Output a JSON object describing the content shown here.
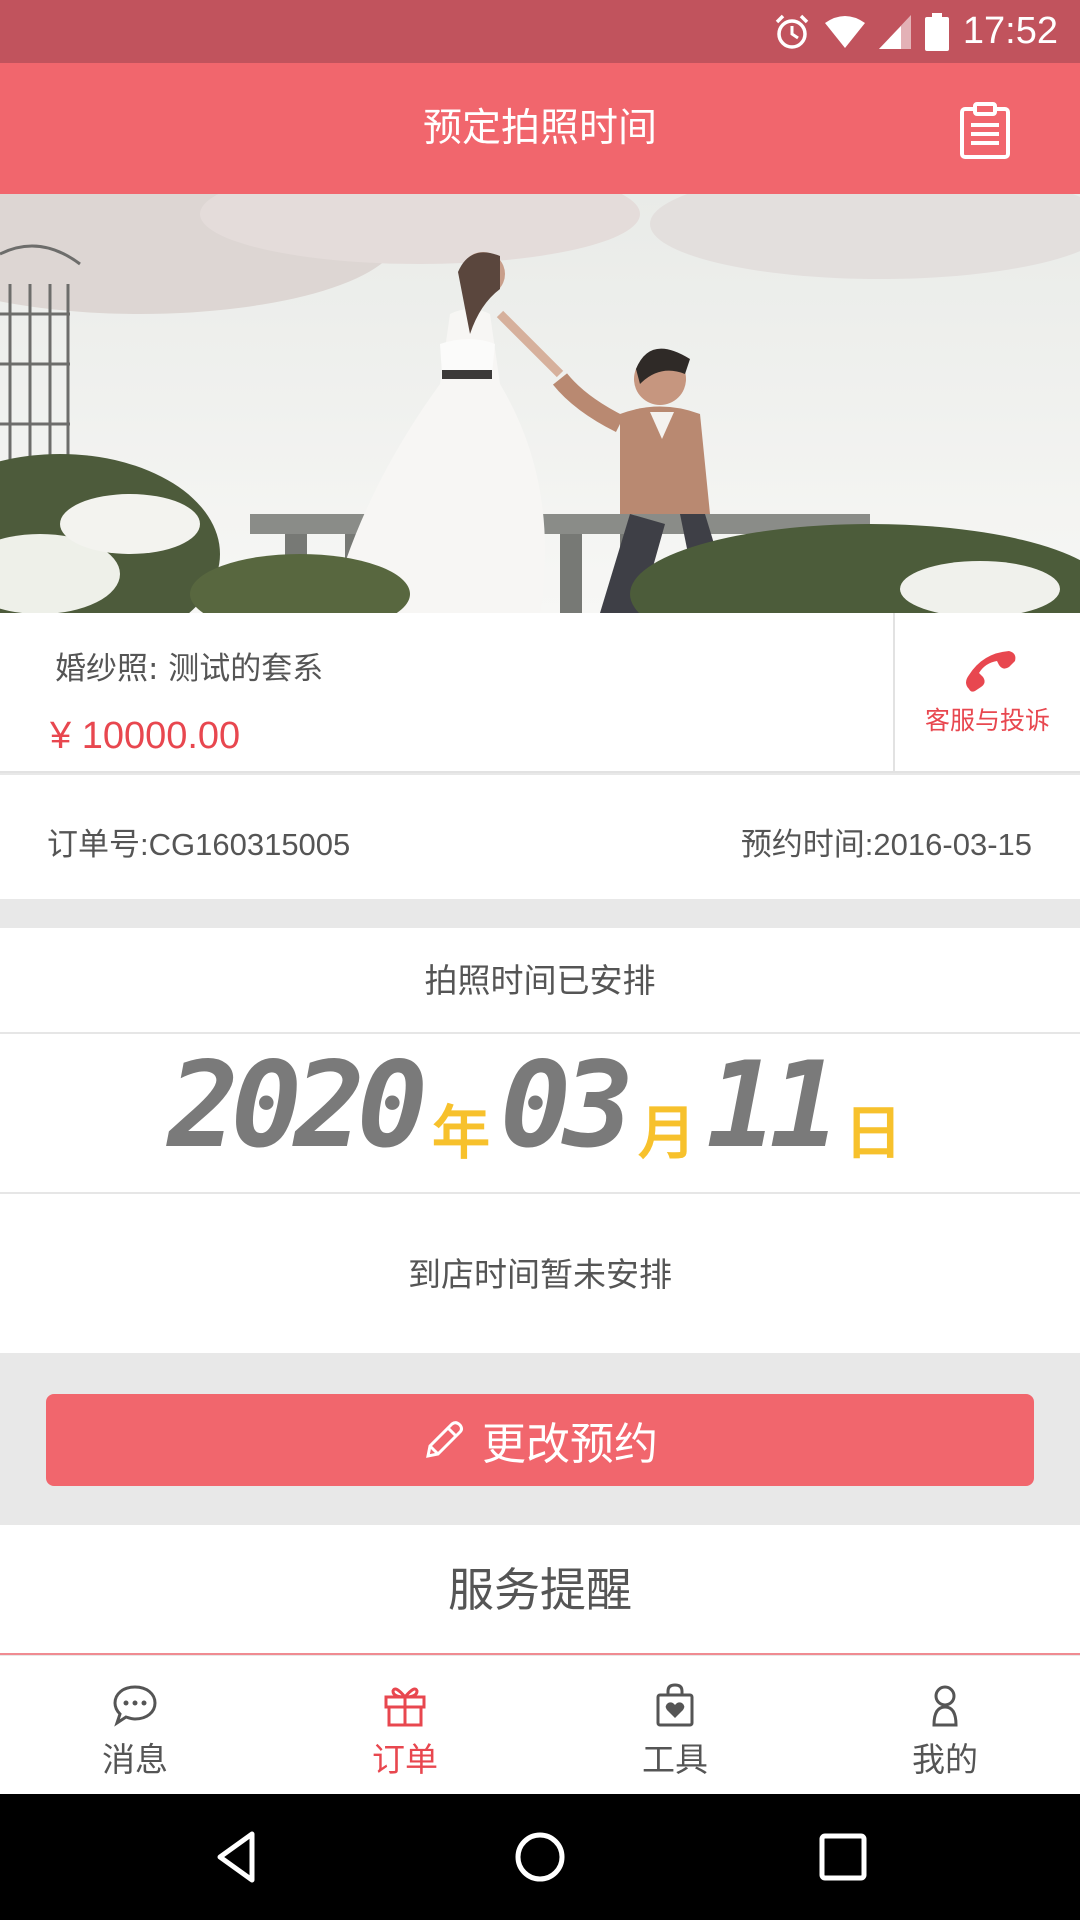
{
  "status_bar": {
    "time": "17:52"
  },
  "header": {
    "title": "预定拍照时间"
  },
  "package": {
    "name": "婚纱照:  测试的套系",
    "price": "¥ 10000.00",
    "service_label": "客服与投诉"
  },
  "order": {
    "number": "订单号:CG160315005",
    "booking_date": "预约时间:2016-03-15"
  },
  "schedule": {
    "status": "拍照时间已安排",
    "year": "2020",
    "year_unit": "年",
    "month": "03",
    "month_unit": "月",
    "day": "11",
    "day_unit": "日",
    "arrival_status": "到店时间暂未安排"
  },
  "change_button": {
    "label": "更改预约"
  },
  "reminder": {
    "title": "服务提醒"
  },
  "tabs": [
    {
      "label": "消息",
      "icon": "chat-bubble-icon"
    },
    {
      "label": "订单",
      "icon": "gift-icon",
      "active": true
    },
    {
      "label": "工具",
      "icon": "bag-heart-icon"
    },
    {
      "label": "我的",
      "icon": "person-icon"
    }
  ],
  "colors": {
    "accent": "#f1666d",
    "status_bar": "#c1535d",
    "price": "#e8474f",
    "date_unit": "#f7c12c",
    "lcd_digits": "#7a7a7a"
  }
}
